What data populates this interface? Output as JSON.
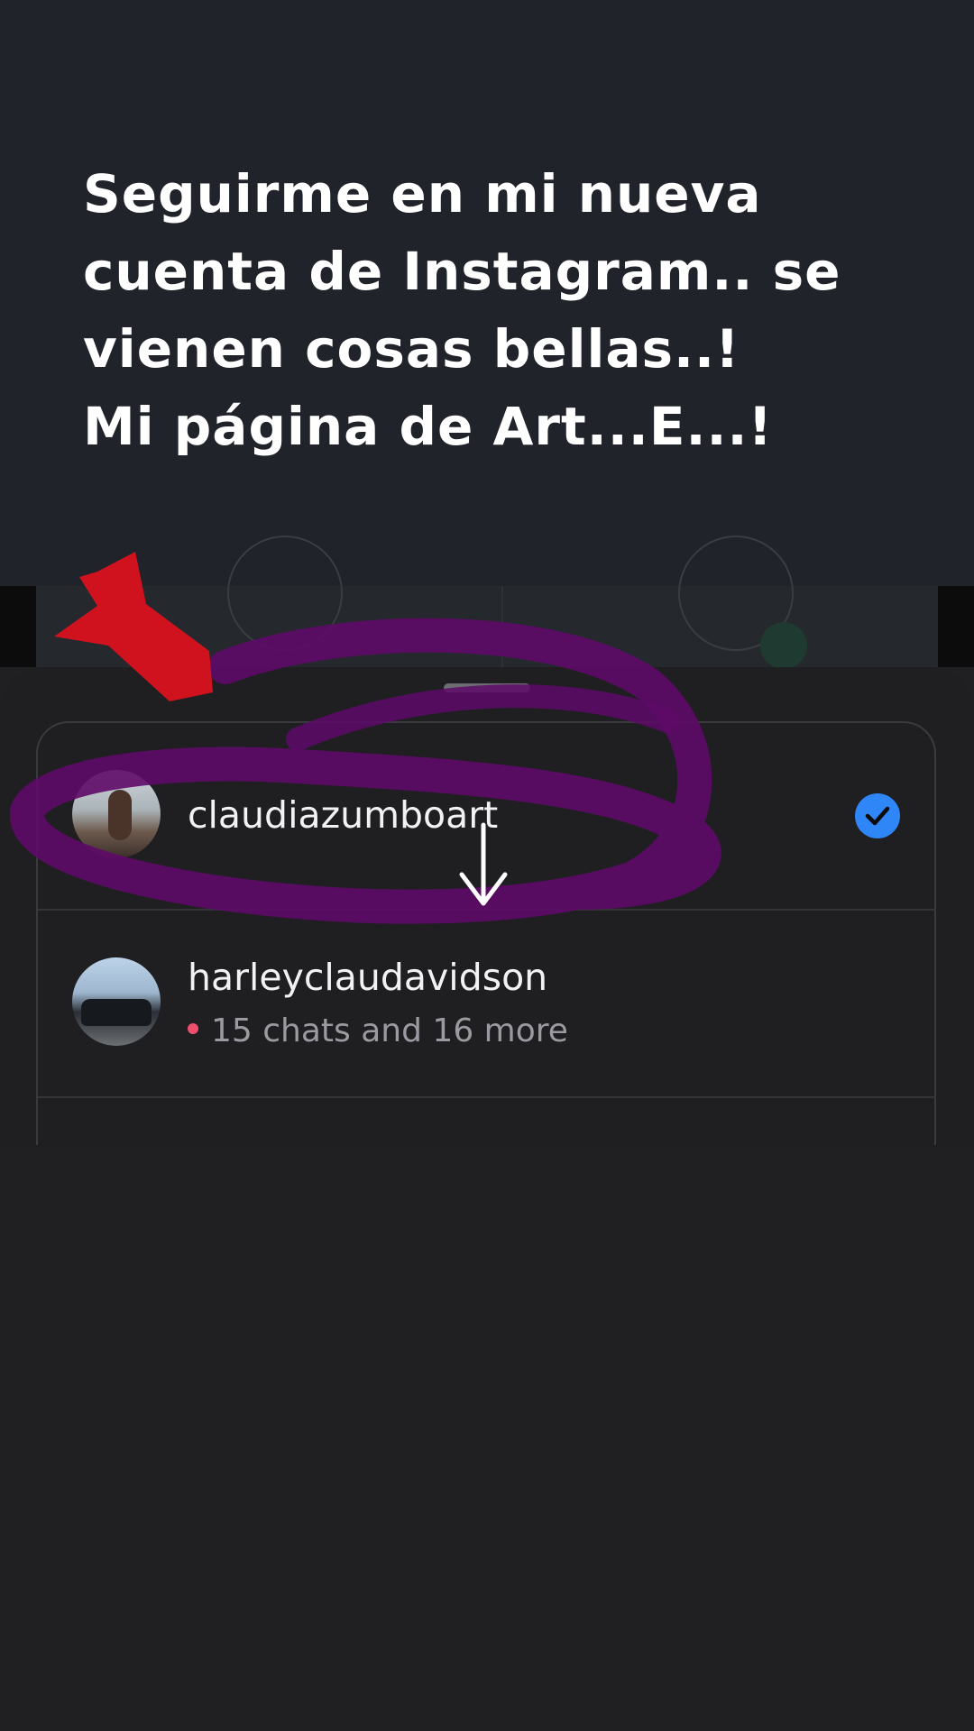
{
  "caption": {
    "lines": [
      "Seguirme en mi nueva",
      "cuenta de Instagram.. se",
      "vienen cosas bellas..!",
      "Mi página de Art...E...!"
    ]
  },
  "sheet": {
    "accounts": [
      {
        "username": "claudiazumboart",
        "selected": true,
        "avatar_icon": "profile-photo"
      },
      {
        "username": "harleyclaudavidson",
        "status": "15 chats and 16 more",
        "status_dot_color": "#f0506e",
        "avatar_icon": "car-photo"
      }
    ]
  },
  "colors": {
    "accent_check": "#2f86f7",
    "annotation_red": "#d0121f",
    "annotation_purple": "#6a0a72"
  }
}
